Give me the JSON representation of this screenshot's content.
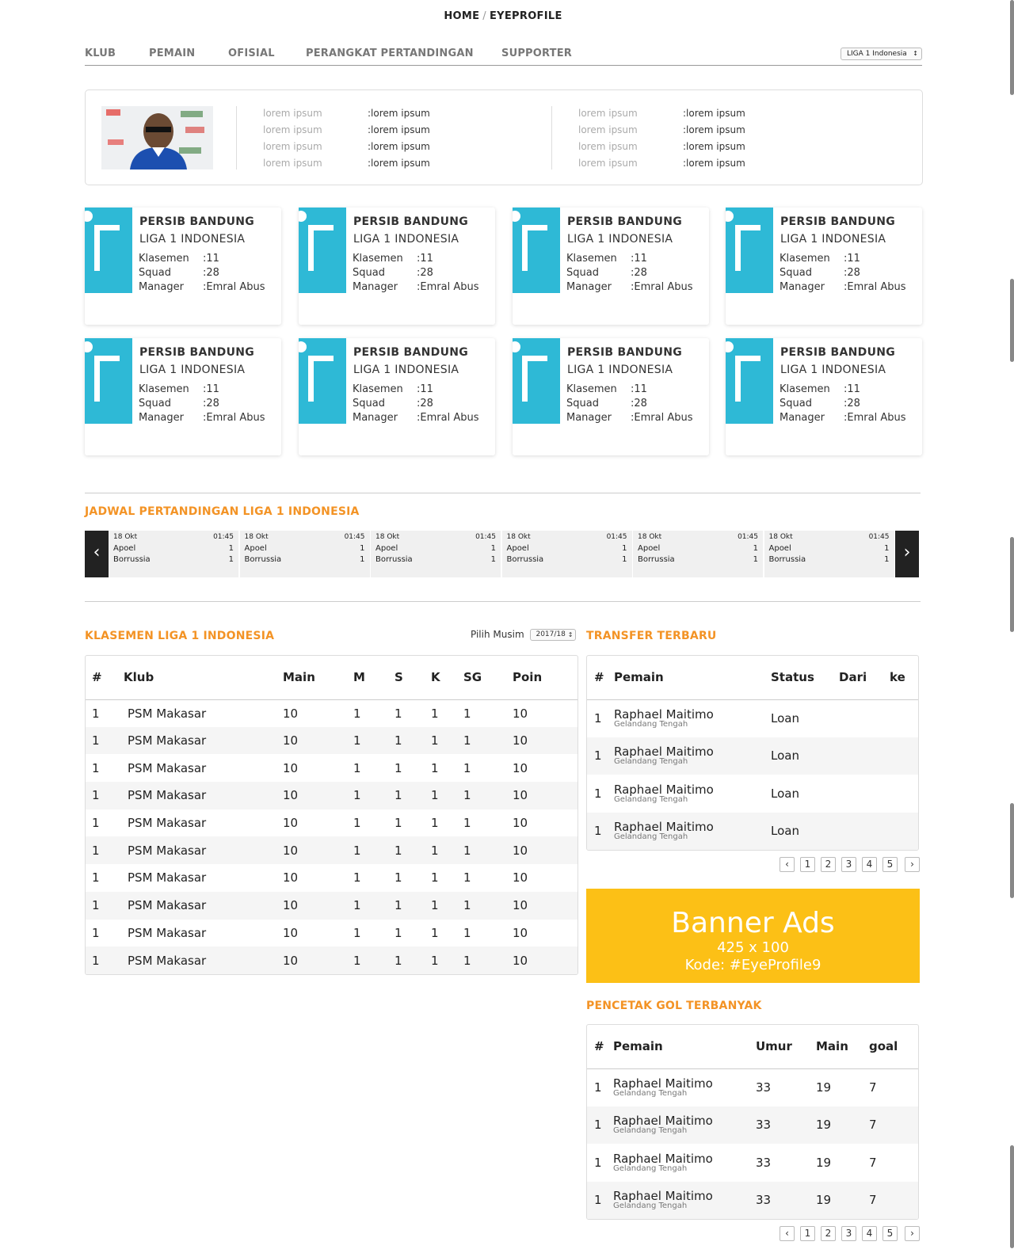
{
  "breadcrumb": {
    "home": "HOME",
    "separator": "/",
    "current": "EYEPROFILE"
  },
  "nav": {
    "tabs": [
      "KLUB",
      "PEMAIN",
      "OFISIAL",
      "PERANGKAT PERTANDINGAN",
      "SUPPORTER"
    ],
    "league_select": "LIGA 1 Indonesia"
  },
  "profile": {
    "left": [
      {
        "label": "lorem ipsum",
        "value": ":lorem ipsum"
      },
      {
        "label": "lorem ipsum",
        "value": ":lorem ipsum"
      },
      {
        "label": "lorem ipsum",
        "value": ":lorem ipsum"
      },
      {
        "label": "lorem ipsum",
        "value": ":lorem ipsum"
      }
    ],
    "right": [
      {
        "label": "lorem ipsum",
        "value": ":lorem ipsum"
      },
      {
        "label": "lorem ipsum",
        "value": ":lorem ipsum"
      },
      {
        "label": "lorem ipsum",
        "value": ":lorem ipsum"
      },
      {
        "label": "lorem ipsum",
        "value": ":lorem ipsum"
      }
    ]
  },
  "clubs": [
    {
      "name": "PERSIB BANDUNG",
      "league": "LIGA 1 INDONESIA",
      "klasemen_label": "Klasemen",
      "klasemen": ":11",
      "squad_label": "Squad",
      "squad": ":28",
      "manager_label": "Manager",
      "manager": ":Emral Abus"
    },
    {
      "name": "PERSIB BANDUNG",
      "league": "LIGA 1 INDONESIA",
      "klasemen_label": "Klasemen",
      "klasemen": ":11",
      "squad_label": "Squad",
      "squad": ":28",
      "manager_label": "Manager",
      "manager": ":Emral Abus"
    },
    {
      "name": "PERSIB BANDUNG",
      "league": "LIGA 1 INDONESIA",
      "klasemen_label": "Klasemen",
      "klasemen": ":11",
      "squad_label": "Squad",
      "squad": ":28",
      "manager_label": "Manager",
      "manager": ":Emral Abus"
    },
    {
      "name": "PERSIB BANDUNG",
      "league": "LIGA 1 INDONESIA",
      "klasemen_label": "Klasemen",
      "klasemen": ":11",
      "squad_label": "Squad",
      "squad": ":28",
      "manager_label": "Manager",
      "manager": ":Emral Abus"
    },
    {
      "name": "PERSIB BANDUNG",
      "league": "LIGA 1 INDONESIA",
      "klasemen_label": "Klasemen",
      "klasemen": ":11",
      "squad_label": "Squad",
      "squad": ":28",
      "manager_label": "Manager",
      "manager": ":Emral Abus"
    },
    {
      "name": "PERSIB BANDUNG",
      "league": "LIGA 1 INDONESIA",
      "klasemen_label": "Klasemen",
      "klasemen": ":11",
      "squad_label": "Squad",
      "squad": ":28",
      "manager_label": "Manager",
      "manager": ":Emral Abus"
    },
    {
      "name": "PERSIB BANDUNG",
      "league": "LIGA 1 INDONESIA",
      "klasemen_label": "Klasemen",
      "klasemen": ":11",
      "squad_label": "Squad",
      "squad": ":28",
      "manager_label": "Manager",
      "manager": ":Emral Abus"
    },
    {
      "name": "PERSIB BANDUNG",
      "league": "LIGA 1 INDONESIA",
      "klasemen_label": "Klasemen",
      "klasemen": ":11",
      "squad_label": "Squad",
      "squad": ":28",
      "manager_label": "Manager",
      "manager": ":Emral Abus"
    }
  ],
  "schedule": {
    "title": "JADWAL PERTANDINGAN LIGA 1 INDONESIA",
    "prev_icon": "‹",
    "next_icon": "›",
    "matches": [
      {
        "date": "18 Okt",
        "time": "01:45",
        "home": "Apoel",
        "home_score": "1",
        "away": "Borrussia",
        "away_score": "1"
      },
      {
        "date": "18 Okt",
        "time": "01:45",
        "home": "Apoel",
        "home_score": "1",
        "away": "Borrussia",
        "away_score": "1"
      },
      {
        "date": "18 Okt",
        "time": "01:45",
        "home": "Apoel",
        "home_score": "1",
        "away": "Borrussia",
        "away_score": "1"
      },
      {
        "date": "18 Okt",
        "time": "01:45",
        "home": "Apoel",
        "home_score": "1",
        "away": "Borrussia",
        "away_score": "1"
      },
      {
        "date": "18 Okt",
        "time": "01:45",
        "home": "Apoel",
        "home_score": "1",
        "away": "Borrussia",
        "away_score": "1"
      },
      {
        "date": "18 Okt",
        "time": "01:45",
        "home": "Apoel",
        "home_score": "1",
        "away": "Borrussia",
        "away_score": "1"
      }
    ]
  },
  "klasemen": {
    "title": "KLASEMEN LIGA 1 INDONESIA",
    "season_label": "Pilih Musim",
    "season_value": "2017/18",
    "columns": [
      "#",
      "Klub",
      "Main",
      "M",
      "S",
      "K",
      "SG",
      "Poin"
    ],
    "rows": [
      [
        "1",
        "PSM Makasar",
        "10",
        "1",
        "1",
        "1",
        "1",
        "10"
      ],
      [
        "1",
        "PSM Makasar",
        "10",
        "1",
        "1",
        "1",
        "1",
        "10"
      ],
      [
        "1",
        "PSM Makasar",
        "10",
        "1",
        "1",
        "1",
        "1",
        "10"
      ],
      [
        "1",
        "PSM Makasar",
        "10",
        "1",
        "1",
        "1",
        "1",
        "10"
      ],
      [
        "1",
        "PSM Makasar",
        "10",
        "1",
        "1",
        "1",
        "1",
        "10"
      ],
      [
        "1",
        "PSM Makasar",
        "10",
        "1",
        "1",
        "1",
        "1",
        "10"
      ],
      [
        "1",
        "PSM Makasar",
        "10",
        "1",
        "1",
        "1",
        "1",
        "10"
      ],
      [
        "1",
        "PSM Makasar",
        "10",
        "1",
        "1",
        "1",
        "1",
        "10"
      ],
      [
        "1",
        "PSM Makasar",
        "10",
        "1",
        "1",
        "1",
        "1",
        "10"
      ],
      [
        "1",
        "PSM Makasar",
        "10",
        "1",
        "1",
        "1",
        "1",
        "10"
      ]
    ]
  },
  "transfer": {
    "title": "TRANSFER TERBARU",
    "columns": [
      "#",
      "Pemain",
      "Status",
      "Dari",
      "ke"
    ],
    "rows": [
      {
        "no": "1",
        "name": "Raphael Maitimo",
        "position": "Gelandang Tengah",
        "status": "Loan",
        "from": "",
        "to": ""
      },
      {
        "no": "1",
        "name": "Raphael Maitimo",
        "position": "Gelandang Tengah",
        "status": "Loan",
        "from": "",
        "to": ""
      },
      {
        "no": "1",
        "name": "Raphael Maitimo",
        "position": "Gelandang Tengah",
        "status": "Loan",
        "from": "",
        "to": ""
      },
      {
        "no": "1",
        "name": "Raphael Maitimo",
        "position": "Gelandang Tengah",
        "status": "Loan",
        "from": "",
        "to": ""
      }
    ],
    "pager": [
      "‹",
      "1",
      "2",
      "3",
      "4",
      "5",
      "›"
    ]
  },
  "banner": {
    "title": "Banner Ads",
    "size": "425 x 100",
    "code": "Kode: #EyeProfile9",
    "color": "#fcc016"
  },
  "pencetak": {
    "title": "PENCETAK GOL TERBANYAK",
    "columns": [
      "#",
      "Pemain",
      "Umur",
      "Main",
      "goal"
    ],
    "rows": [
      {
        "no": "1",
        "name": "Raphael Maitimo",
        "position": "Gelandang Tengah",
        "age": "33",
        "played": "19",
        "goals": "7"
      },
      {
        "no": "1",
        "name": "Raphael Maitimo",
        "position": "Gelandang Tengah",
        "age": "33",
        "played": "19",
        "goals": "7"
      },
      {
        "no": "1",
        "name": "Raphael Maitimo",
        "position": "Gelandang Tengah",
        "age": "33",
        "played": "19",
        "goals": "7"
      },
      {
        "no": "1",
        "name": "Raphael Maitimo",
        "position": "Gelandang Tengah",
        "age": "33",
        "played": "19",
        "goals": "7"
      }
    ],
    "pager": [
      "‹",
      "1",
      "2",
      "3",
      "4",
      "5",
      "›"
    ]
  },
  "colors": {
    "accent": "#f39325",
    "club_logo": "#2eb9d6",
    "banner": "#fcc016"
  }
}
